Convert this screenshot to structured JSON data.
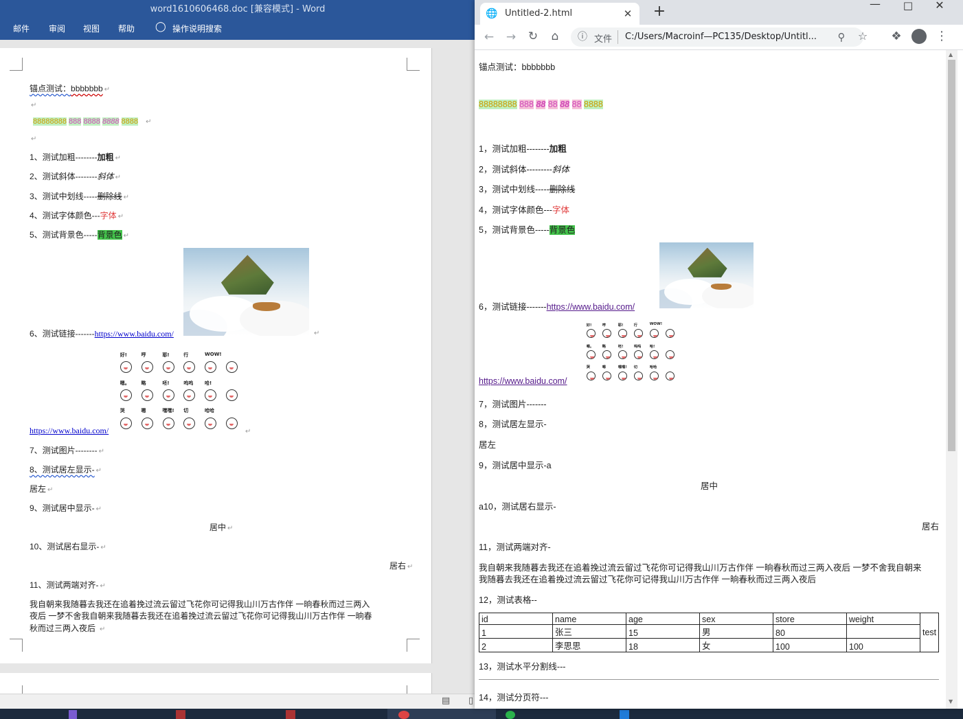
{
  "word": {
    "title": "word1610606468.doc [兼容模式]  -  Word",
    "tabs": [
      "邮件",
      "审阅",
      "视图",
      "帮助",
      "操作说明搜索"
    ],
    "lines": {
      "anchor_label": "锚点测试：",
      "anchor_value": "bbbbbbb",
      "eights_a": "88888888",
      "eights_b": "888",
      "eights_c": "8888",
      "eights_d": "8888",
      "eights_e": "8888",
      "bold_label": "1、测试加粗--------",
      "bold_value": "加粗",
      "italic_label": "2、测试斜体--------",
      "italic_value": "斜体",
      "strike_label": "3、测试中划线-----",
      "strike_value": "删除线",
      "color_label": "4、测试字体颜色---",
      "color_value": "字体",
      "bg_label": "5、测试背景色-----",
      "bg_value": "背景色",
      "link_label": "6、测试链接-------",
      "link_value": "https://www.baidu.com/",
      "link2_value": "https://www.baidu.com/",
      "image_label": "7、测试图片--------",
      "left_label": "8、测试居左显示-",
      "left_value": "居左",
      "center_label": "9、测试居中显示-",
      "center_value": "居中",
      "right_label": "10、测试居右显示-",
      "right_value": "居右",
      "justify_label": "11、测试两端对齐-",
      "justify_l1": " 我自朝来我随暮去我还在追着挽过流云留过飞花你可记得我山川万古作伴  一晌春秋而过三两入",
      "justify_l2": "夜后  一梦不舍我自朝来我随暮去我还在追着挽过流云留过飞花你可记得我山川万古作伴  一晌春",
      "justify_l3": "秋而过三两入夜后"
    }
  },
  "chrome": {
    "tab_title": "Untitled-2.html",
    "url_prefix": "文件",
    "url": "C:/Users/Macroinf—PC135/Desktop/Untitl...",
    "content": {
      "anchor": "锚点测试：bbbbbbb",
      "eights_a": "88888888",
      "eights_b": "888",
      "eights_c": "88",
      "eights_d": "88",
      "eights_e": "88",
      "eights_f": "88",
      "eights_g": "8888",
      "bold_label": "1，测试加粗--------",
      "bold_value": "加粗",
      "italic_label": "2，测试斜体---------",
      "italic_value": "斜体",
      "strike_label": "3，测试中划线-----",
      "strike_value": "删除线",
      "color_label": "4，测试字体颜色---",
      "color_value": "字体",
      "bg_label": "5，测试背景色-----",
      "bg_value": "背景色",
      "link_label": "6，测试链接-------",
      "link_value": "https://www.baidu.com/",
      "link2_value": "https://www.baidu.com/",
      "image_label": "7，测试图片-------",
      "left_label": "8，测试居左显示-",
      "left_value": "居左",
      "center_label": "9，测试居中显示-a",
      "center_value": "居中",
      "right_label": "a10，测试居右显示-",
      "right_value": "居右",
      "justify_label": "11，测试两端对齐-",
      "justify_l1": "我自朝来我随暮去我还在追着挽过流云留过飞花你可记得我山川万古作伴 一晌春秋而过三两入夜后 一梦不舍我自朝来",
      "justify_l2": "我随暮去我还在追着挽过流云留过飞花你可记得我山川万古作伴 一晌春秋而过三两入夜后",
      "table_label": "12，测试表格--",
      "table": {
        "headers": [
          "id",
          "name",
          "age",
          "sex",
          "store",
          "weight"
        ],
        "rows": [
          [
            "1",
            "张三",
            "15",
            "男",
            "80",
            ""
          ],
          [
            "2",
            "李思思",
            "18",
            "女",
            "100",
            "100"
          ]
        ],
        "extra": "test"
      },
      "hr_label": "13，测试水平分割线---",
      "pagebreak_label": "14，测试分页符---"
    }
  },
  "stickers": [
    "好!",
    "哼",
    "耶!",
    "行",
    "WOW!",
    "嗯。",
    "略",
    "呸!",
    "呜呜",
    "哈!",
    "哭",
    "嗯",
    "嘿嘿!",
    "切",
    "哈哈"
  ]
}
